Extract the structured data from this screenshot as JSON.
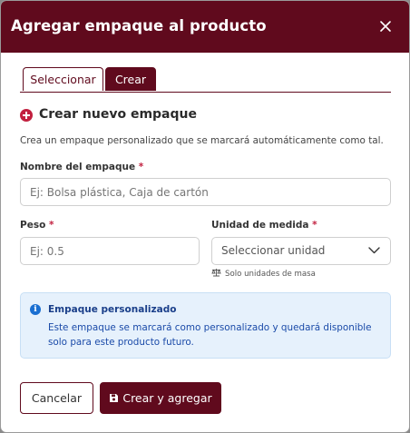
{
  "modal": {
    "title": "Agregar empaque al producto",
    "close_icon": "close-icon"
  },
  "tabs": [
    {
      "label": "Seleccionar",
      "active": false
    },
    {
      "label": "Crear",
      "active": true
    }
  ],
  "section": {
    "icon": "plus-circle-icon",
    "title": "Crear nuevo empaque",
    "description": "Crea un empaque personalizado que se marcará automáticamente como tal."
  },
  "form": {
    "name": {
      "label": "Nombre del empaque",
      "required": "*",
      "value": "",
      "placeholder": "Ej: Bolsa plástica, Caja de cartón"
    },
    "weight": {
      "label": "Peso",
      "required": "*",
      "value": "",
      "placeholder": "Ej: 0.5"
    },
    "unit": {
      "label": "Unidad de medida",
      "required": "*",
      "selected": "Seleccionar unidad",
      "hint": "Solo unidades de masa",
      "hint_icon": "scale-icon"
    }
  },
  "alert": {
    "icon": "info-icon",
    "title": "Empaque personalizado",
    "text": "Este empaque se marcará como personalizado y quedará disponible solo para este producto futuro."
  },
  "footer": {
    "cancel_label": "Cancelar",
    "create_label": "Crear y agregar",
    "create_icon": "save-icon"
  },
  "colors": {
    "brand": "#600a1d",
    "required": "#c2203f",
    "info_bg": "#e6f1fc",
    "info_text": "#1a4aa8"
  }
}
